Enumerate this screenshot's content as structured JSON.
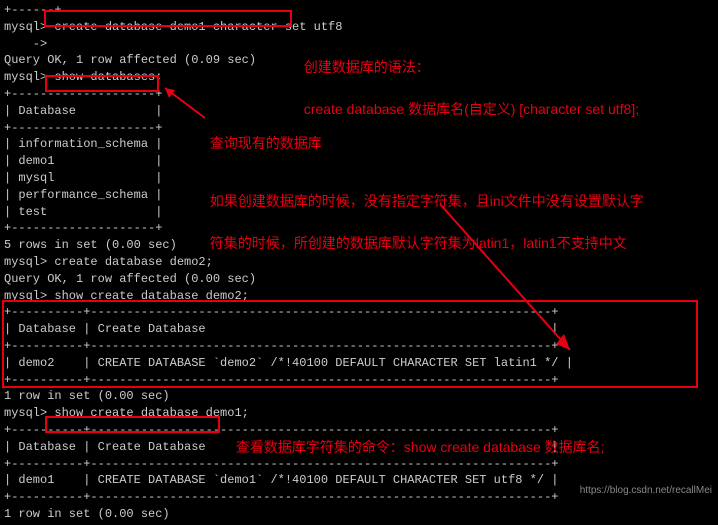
{
  "terminal": {
    "line00": "+------+",
    "line01": "mysql> create database demo1 character set utf8",
    "line02": "    ->",
    "line03": "Query OK, 1 row affected (0.09 sec)",
    "line04": "",
    "line05": "mysql> show databases;",
    "line06": "+--------------------+",
    "line07": "| Database           |",
    "line08": "+--------------------+",
    "line09": "| information_schema |",
    "line10": "| demo1              |",
    "line11": "| mysql              |",
    "line12": "| performance_schema |",
    "line13": "| test               |",
    "line14": "+--------------------+",
    "line15": "5 rows in set (0.00 sec)",
    "line16": "",
    "line17": "mysql> create database demo2;",
    "line18": "Query OK, 1 row affected (0.00 sec)",
    "line19": "",
    "line20": "mysql> show create database demo2;",
    "line21": "+----------+----------------------------------------------------------------+",
    "line22": "| Database | Create Database                                                |",
    "line23": "+----------+----------------------------------------------------------------+",
    "line24": "| demo2    | CREATE DATABASE `demo2` /*!40100 DEFAULT CHARACTER SET latin1 */ |",
    "line25": "+----------+----------------------------------------------------------------+",
    "line26": "1 row in set (0.00 sec)",
    "line27": "",
    "line28": "mysql> show create database demo1;",
    "line29": "+----------+----------------------------------------------------------------+",
    "line30": "| Database | Create Database                                                |",
    "line31": "+----------+----------------------------------------------------------------+",
    "line32": "| demo1    | CREATE DATABASE `demo1` /*!40100 DEFAULT CHARACTER SET utf8 */ |",
    "line33": "+----------+----------------------------------------------------------------+",
    "line34": "1 row in set (0.00 sec)"
  },
  "annotations": {
    "a1_line1": "创建数据库的语法：",
    "a1_line2": "create database 数据库名(自定义) [character set utf8];",
    "a2": "查询现有的数据库",
    "a3_line1": "如果创建数据库的时候，没有指定字符集，且ini文件中没有设置默认字",
    "a3_line2": "符集的时候，所创建的数据库默认字符集为latin1，latin1不支持中文",
    "a4": "查看数据库字符集的命令：show create database 数据库名;"
  },
  "colors": {
    "accent": "#e60012"
  },
  "watermark": "https://blog.csdn.net/recallMei"
}
